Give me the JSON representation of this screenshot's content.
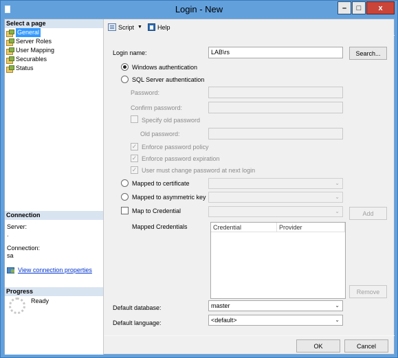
{
  "window": {
    "title": "Login - New",
    "minimize_glyph": "–",
    "maximize_glyph": "□",
    "close_glyph": "x"
  },
  "sidebar": {
    "select_page_heading": "Select a page",
    "pages": [
      {
        "label": "General",
        "selected": true
      },
      {
        "label": "Server Roles"
      },
      {
        "label": "User Mapping"
      },
      {
        "label": "Securables"
      },
      {
        "label": "Status"
      }
    ],
    "connection_heading": "Connection",
    "server_label": "Server:",
    "server_value": ".",
    "connection_label": "Connection:",
    "connection_value": "sa",
    "view_connection_properties": "View connection properties",
    "progress_heading": "Progress",
    "progress_status": "Ready"
  },
  "toolbar": {
    "script_label": "Script",
    "help_label": "Help"
  },
  "form": {
    "login_name_label": "Login name:",
    "login_name_value": "LAB\\rs",
    "search_button": "Search...",
    "windows_auth_label": "Windows authentication",
    "sql_auth_label": "SQL Server authentication",
    "password_label": "Password:",
    "confirm_password_label": "Confirm password:",
    "specify_old_password_label": "Specify old password",
    "old_password_label": "Old password:",
    "enforce_policy_label": "Enforce password policy",
    "enforce_expiration_label": "Enforce password expiration",
    "must_change_label": "User must change password at next login",
    "mapped_certificate_label": "Mapped to certificate",
    "mapped_asym_key_label": "Mapped to asymmetric key",
    "map_credential_label": "Map to Credential",
    "add_button": "Add",
    "mapped_credentials_label": "Mapped Credentials",
    "grid_columns": [
      "Credential",
      "Provider"
    ],
    "remove_button": "Remove",
    "default_database_label": "Default database:",
    "default_database_value": "master",
    "default_language_label": "Default language:",
    "default_language_value": "<default>"
  },
  "buttons": {
    "ok": "OK",
    "cancel": "Cancel"
  },
  "icons": {
    "dropdown_arrow": "⌄",
    "checkmark": "✓"
  },
  "colors": {
    "title_bar": "#62a0dc",
    "selection": "#3399ff",
    "close_button": "#c9453a",
    "section_heading": "#d9e4f1"
  }
}
